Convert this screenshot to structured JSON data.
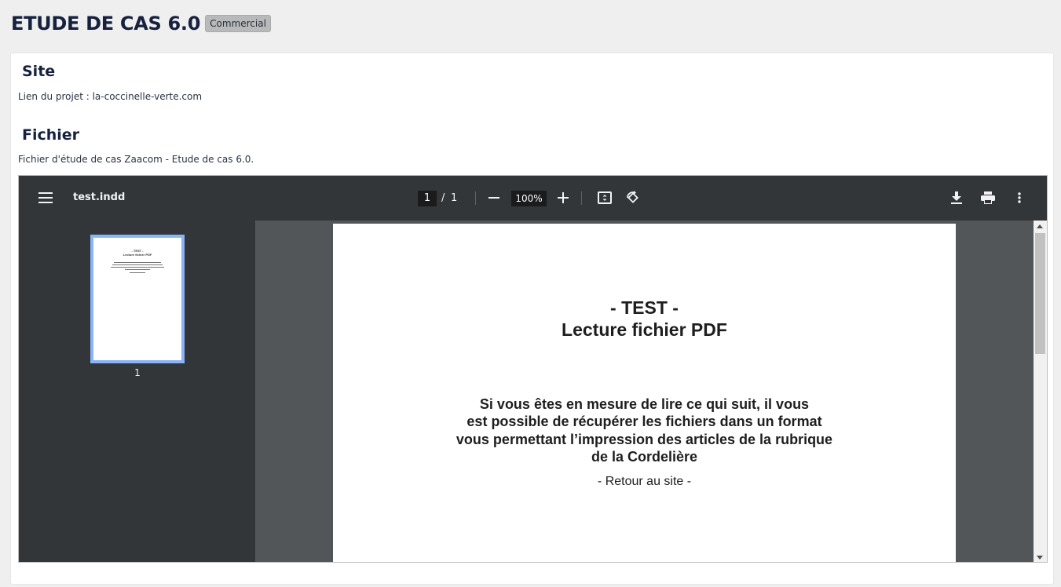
{
  "header": {
    "title": "ETUDE DE CAS 6.0",
    "badge": "Commercial"
  },
  "site": {
    "heading": "Site",
    "link_text": "Lien du projet : la-coccinelle-verte.com"
  },
  "file": {
    "heading": "Fichier",
    "description": "Fichier d'étude de cas Zaacom - Etude de cas 6.0."
  },
  "viewer": {
    "doc_name": "test.indd",
    "current_page": "1",
    "page_separator": "/",
    "total_pages": "1",
    "zoom": "100%",
    "icons": {
      "menu": "menu-icon",
      "zoom_out": "minus-icon",
      "zoom_in": "plus-icon",
      "fit": "fit-page-icon",
      "rotate": "rotate-icon",
      "download": "download-icon",
      "print": "print-icon",
      "more": "more-vert-icon"
    },
    "thumbnail_label": "1",
    "page": {
      "title_line1": "- TEST -",
      "title_line2": "Lecture fichier PDF",
      "body_line1": "Si vous êtes en mesure de lire ce qui suit, il vous",
      "body_line2": "est possible de récupérer les fichiers dans un format",
      "body_line3": "vous permettant l’impression des articles de la rubrique",
      "body_line4": "de la Cordelière",
      "link": "- Retour au site -"
    }
  },
  "colors": {
    "toolbar": "#323639",
    "viewer_bg": "#525659",
    "thumb_border": "#8ab4f8",
    "title": "#16213e",
    "badge_bg": "#b8b9bb"
  }
}
